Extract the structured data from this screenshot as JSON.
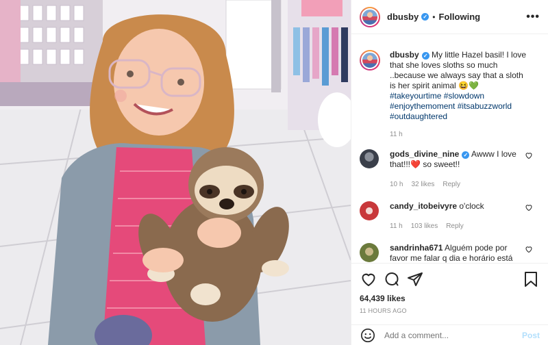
{
  "header": {
    "username": "dbusby",
    "separator": "•",
    "follow_label": "Following",
    "more_label": "•••"
  },
  "caption": {
    "username": "dbusby",
    "text": " My little Hazel basil! I love that she loves sloths so much ..because we always say that a sloth is her spirit animal ",
    "emoji": "😆💚",
    "hashtags": [
      "#takeyourtime",
      "#slowdown",
      "#enjoythemoment",
      "#itsabuzzworld",
      "#outdaughtered"
    ],
    "time": "11 h"
  },
  "comments": [
    {
      "username": "gods_divine_nine",
      "verified": true,
      "text": " Awww I love that!!!",
      "emoji": "❤️",
      "text_after": " so sweet!!",
      "time": "10 h",
      "likes": "32 likes",
      "reply": "Reply",
      "avatar_color": "#3a3f4a"
    },
    {
      "username": "candy_itobeivyre",
      "verified": false,
      "text": " o'clock",
      "time": "11 h",
      "likes": "103 likes",
      "reply": "Reply",
      "avatar_color": "#c8383a"
    },
    {
      "username": "sandrinha671",
      "verified": false,
      "text": " Alguém pode por favor me falar q dia e horário está",
      "time": "",
      "likes": "",
      "reply": "",
      "avatar_color": "#6b7a3c"
    }
  ],
  "actions": {
    "likes": "64,439 likes",
    "posted": "11 HOURS AGO"
  },
  "composer": {
    "placeholder": "Add a comment...",
    "post_label": "Post"
  },
  "colors": {
    "accent": "#0095f6",
    "verified": "#3897f0",
    "hashtag": "#00376b",
    "muted": "#8e8e8e",
    "post_disabled": "#b2dffc"
  },
  "icons": {
    "like": "heart-icon",
    "comment": "comment-icon",
    "share": "paper-plane-icon",
    "save": "bookmark-icon",
    "emoji": "smiley-icon",
    "comment_like": "small-heart-icon"
  }
}
